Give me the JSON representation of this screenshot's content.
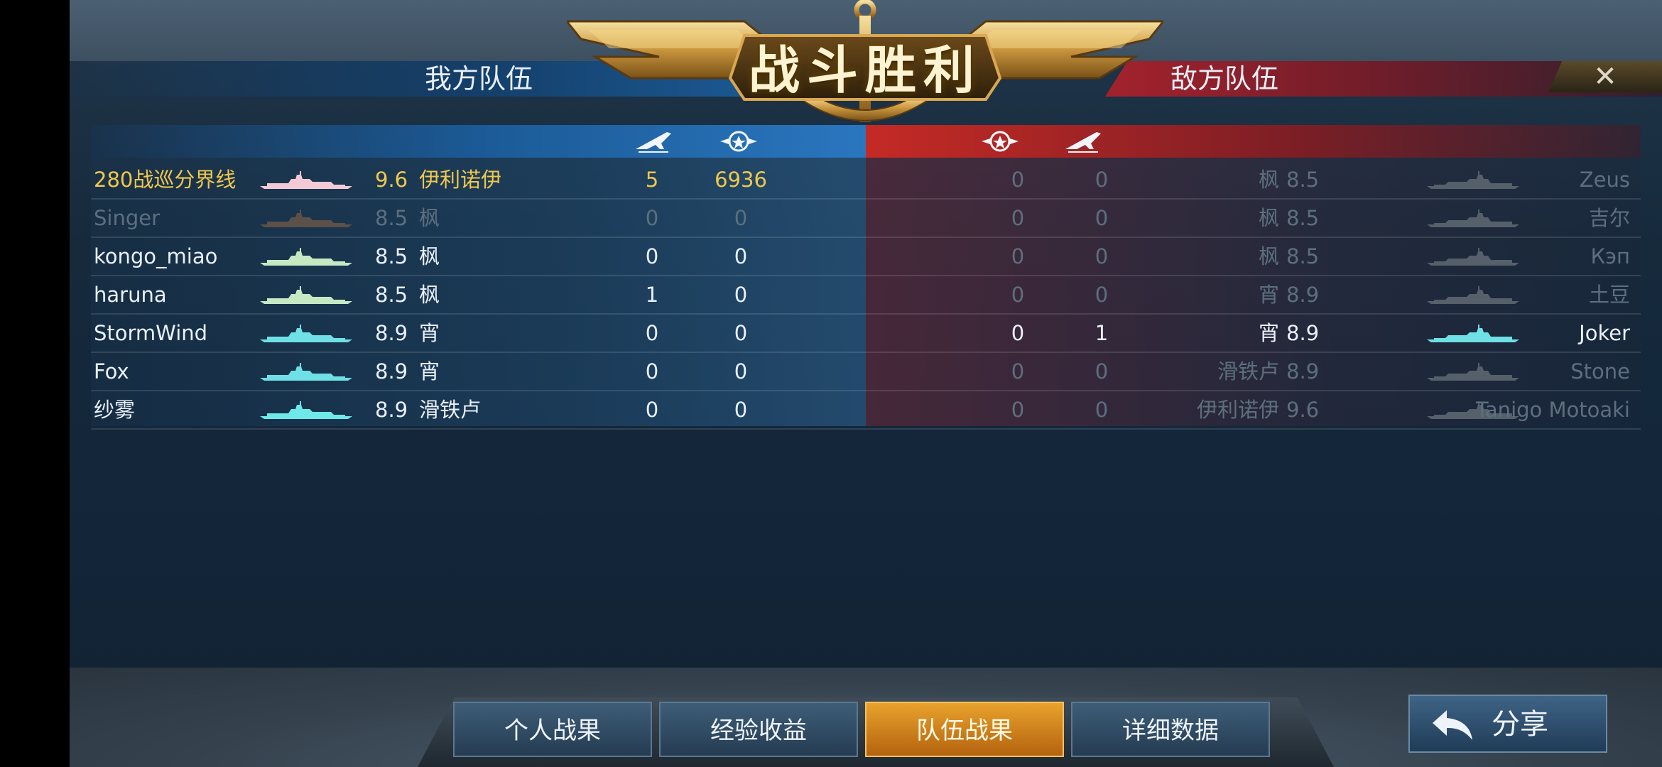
{
  "title": "战斗胜利",
  "teams": {
    "ally_label": "我方队伍",
    "enemy_label": "敌方队伍",
    "close_symbol": "✕"
  },
  "header_icons": [
    "plane-icon",
    "rank-badge-icon",
    "rank-badge-icon",
    "plane-icon"
  ],
  "ally_rows": [
    {
      "name": "280战巡分界线",
      "rating": "9.6",
      "ship": "伊利诺伊",
      "stat1": "5",
      "stat2": "6936",
      "style": "yellow",
      "ship_color": "#f3c9d6"
    },
    {
      "name": "Singer",
      "rating": "8.5",
      "ship": "枫",
      "stat1": "0",
      "stat2": "0",
      "style": "dim",
      "ship_color": "#5c5048"
    },
    {
      "name": "kongo_miao",
      "rating": "8.5",
      "ship": "枫",
      "stat1": "0",
      "stat2": "0",
      "style": "white",
      "ship_color": "#c6e9c4"
    },
    {
      "name": "haruna",
      "rating": "8.5",
      "ship": "枫",
      "stat1": "1",
      "stat2": "0",
      "style": "white",
      "ship_color": "#c6e9c4"
    },
    {
      "name": "StormWind",
      "rating": "8.9",
      "ship": "宵",
      "stat1": "0",
      "stat2": "0",
      "style": "white",
      "ship_color": "#6fe0e6"
    },
    {
      "name": "Fox",
      "rating": "8.9",
      "ship": "宵",
      "stat1": "0",
      "stat2": "0",
      "style": "white",
      "ship_color": "#6fe0e6"
    },
    {
      "name": "纱雾",
      "rating": "8.9",
      "ship": "滑铁卢",
      "stat1": "0",
      "stat2": "0",
      "style": "white",
      "ship_color": "#6fe8ea"
    }
  ],
  "enemy_rows": [
    {
      "name": "Zeus",
      "rating": "8.5",
      "ship": "枫",
      "stat1": "0",
      "stat2": "0",
      "style": "dim",
      "ship_color": "#55606a"
    },
    {
      "name": "吉尔",
      "rating": "8.5",
      "ship": "枫",
      "stat1": "0",
      "stat2": "0",
      "style": "dim",
      "ship_color": "#55606a"
    },
    {
      "name": "Кэп",
      "rating": "8.5",
      "ship": "枫",
      "stat1": "0",
      "stat2": "0",
      "style": "dim",
      "ship_color": "#55606a"
    },
    {
      "name": "土豆",
      "rating": "8.9",
      "ship": "宵",
      "stat1": "0",
      "stat2": "0",
      "style": "dim",
      "ship_color": "#55606a"
    },
    {
      "name": "Joker",
      "rating": "8.9",
      "ship": "宵",
      "stat1": "0",
      "stat2": "1",
      "style": "white",
      "ship_color": "#6fe0e6"
    },
    {
      "name": "Stone",
      "rating": "8.9",
      "ship": "滑铁卢",
      "stat1": "0",
      "stat2": "0",
      "style": "dim",
      "ship_color": "#55606a"
    },
    {
      "name": "Tanigo Motoaki",
      "rating": "9.6",
      "ship": "伊利诺伊",
      "stat1": "0",
      "stat2": "0",
      "style": "dim",
      "ship_color": "#55606a"
    }
  ],
  "tabs": [
    {
      "label": "个人战果",
      "active": false
    },
    {
      "label": "经验收益",
      "active": false
    },
    {
      "label": "队伍战果",
      "active": true
    },
    {
      "label": "详细数据",
      "active": false
    }
  ],
  "share_label": "分享",
  "colors": {
    "ally_accent": "#1d5f9c",
    "enemy_accent": "#a3222c",
    "highlight": "#f0c84c",
    "active_tab": "#e9a22c"
  }
}
